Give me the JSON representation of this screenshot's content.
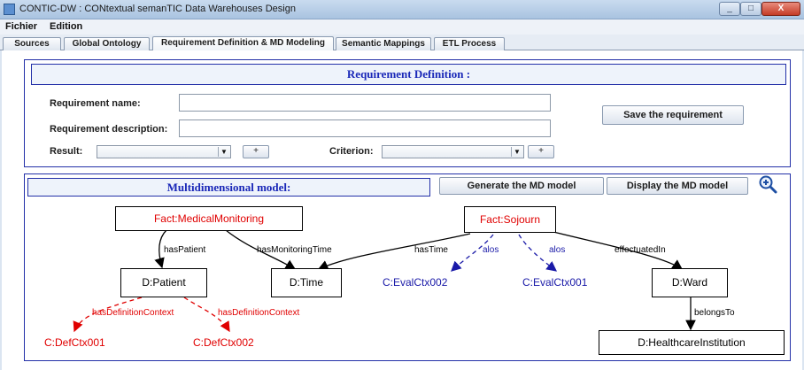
{
  "window": {
    "title": "CONTIC-DW : CONtextual semanTIC Data Warehouses Design",
    "minimize": "_",
    "maximize": "□",
    "close": "X"
  },
  "menu": [
    "Fichier",
    "Edition"
  ],
  "tabs": [
    {
      "label": "Sources"
    },
    {
      "label": "Global Ontology"
    },
    {
      "label": "Requirement Definition & MD Modeling",
      "active": true
    },
    {
      "label": "Semantic Mappings"
    },
    {
      "label": "ETL Process"
    }
  ],
  "requirement": {
    "title": "Requirement Definition :",
    "name_label": "Requirement name:",
    "name_value": "",
    "desc_label": "Requirement description:",
    "desc_value": "",
    "save_button": "Save the requirement",
    "result_label": "Result:",
    "result_value": "",
    "result_add": "+",
    "criterion_label": "Criterion:",
    "criterion_value": "",
    "criterion_add": "+"
  },
  "md": {
    "title": "Multidimensional model:",
    "generate_button": "Generate the MD model",
    "display_button": "Display the MD model",
    "zoom_icon": "zoom-in-icon",
    "nodes": {
      "fact_medical": "Fact:MedicalMonitoring",
      "fact_sojourn": "Fact:Sojourn",
      "dim_patient": "D:Patient",
      "dim_time": "D:Time",
      "dim_ward": "D:Ward",
      "dim_healthcare": "D:HealthcareInstitution",
      "ctx_eval002": "C:EvalCtx002",
      "ctx_eval001": "C:EvalCtx001",
      "ctx_def001": "C:DefCtx001",
      "ctx_def002": "C:DefCtx002"
    },
    "edges": {
      "has_patient": "hasPatient",
      "has_monitoring_time": "hasMonitoringTime",
      "has_time": "hasTime",
      "alos_1": "alos",
      "alos_2": "alos",
      "effectuated_in": "effectuatedIn",
      "belongs_to": "belongsTo",
      "has_def_ctx_1": "hasDefinitionContext",
      "has_def_ctx_2": "hasDefinitionContext"
    },
    "colors": {
      "black": "#000000",
      "context_blue": "#1a1aa8",
      "def_red": "#e00000"
    }
  }
}
